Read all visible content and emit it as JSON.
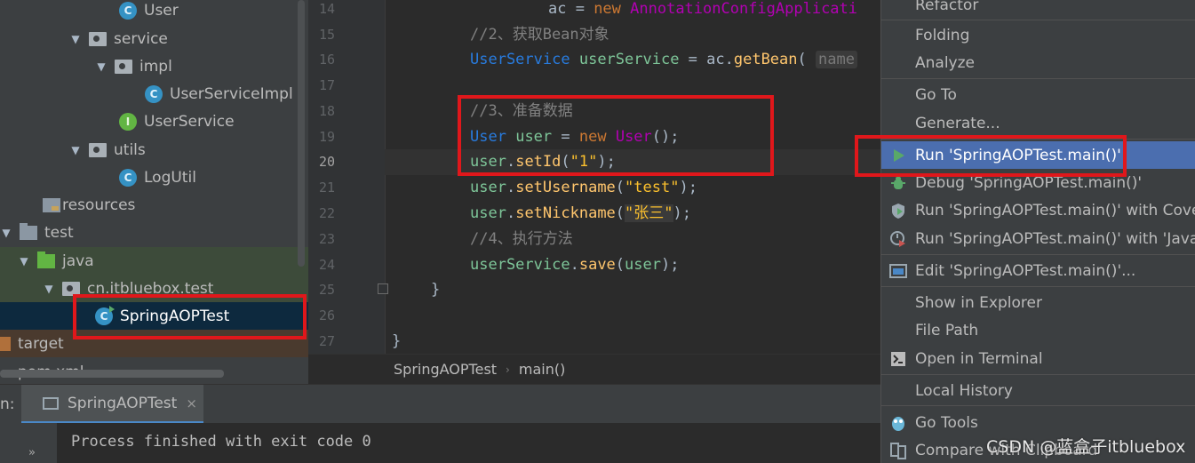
{
  "project_tree": {
    "items": [
      {
        "label": "User",
        "icon": "class-icon"
      },
      {
        "label": "service",
        "icon": "package-icon"
      },
      {
        "label": "impl",
        "icon": "package-icon"
      },
      {
        "label": "UserServiceImpl",
        "icon": "class-icon"
      },
      {
        "label": "UserService",
        "icon": "interface-icon"
      },
      {
        "label": "utils",
        "icon": "package-icon"
      },
      {
        "label": "LogUtil",
        "icon": "class-icon"
      },
      {
        "label": "resources",
        "icon": "resources-folder-icon"
      },
      {
        "label": "test",
        "icon": "folder-icon"
      },
      {
        "label": "java",
        "icon": "test-source-folder-icon"
      },
      {
        "label": "cn.itbluebox.test",
        "icon": "package-icon"
      },
      {
        "label": "SpringAOPTest",
        "icon": "runnable-class-icon"
      },
      {
        "label": "target",
        "icon": "excluded-folder-icon"
      },
      {
        "label": "pom.xml",
        "icon": "maven-icon"
      }
    ]
  },
  "editor": {
    "line_numbers": [
      "14",
      "15",
      "16",
      "17",
      "18",
      "19",
      "20",
      "21",
      "22",
      "23",
      "24",
      "25",
      "26",
      "27"
    ],
    "current_line": "20",
    "code": {
      "l14_assign": "ac = ",
      "l14_new": "new ",
      "l14_class": "AnnotationConfigApplicati",
      "l15": "//2、获取Bean对象",
      "l16_type": "UserService",
      "l16_var": "userService",
      "l16_eq": " = ac.",
      "l16_fn": "getBean",
      "l16_paren": "( ",
      "l16_hint": "name",
      "l18": "//3、准备数据",
      "l19_type": "User",
      "l19_var": "user",
      "l19_eq": " = ",
      "l19_new": "new ",
      "l19_class": "User",
      "l19_end": "();",
      "l20_obj": "user",
      "l20_dot": ".",
      "l20_fn": "setId",
      "l20_open": "(",
      "l20_str": "\"1\"",
      "l20_close": ");",
      "l21_obj": "user",
      "l21_fn": "setUsername",
      "l21_str": "\"test\"",
      "l22_obj": "user",
      "l22_fn": "setNickname",
      "l22_str": "\"张三\"",
      "l23": "//4、执行方法",
      "l24_obj": "userService",
      "l24_fn": "save",
      "l24_arg": "user",
      "l25": "}",
      "l27": "}"
    },
    "breadcrumb": [
      "SpringAOPTest",
      "main()"
    ]
  },
  "run_panel": {
    "label": "n:",
    "tab_label": "SpringAOPTest",
    "tab_close": "×",
    "expand": "»",
    "console_output": "Process finished with exit code 0"
  },
  "context_menu": {
    "items": {
      "refactor": "Refactor",
      "folding": "Folding",
      "analyze": "Analyze",
      "goto": "Go To",
      "generate": "Generate...",
      "run": "Run 'SpringAOPTest.main()'",
      "debug": "Debug 'SpringAOPTest.main()'",
      "run_coverage": "Run 'SpringAOPTest.main()' with Covera",
      "run_flight": "Run 'SpringAOPTest.main()' with 'Java F",
      "edit_config": "Edit 'SpringAOPTest.main()'...",
      "show_explorer": "Show in Explorer",
      "file_path": "File Path",
      "open_terminal": "Open in Terminal",
      "local_history": "Local History",
      "go_tools": "Go Tools",
      "compare_clipboard": "Compare with Clipboard"
    }
  },
  "watermark": "CSDN @蓝盒子itbluebox",
  "colors": {
    "annotation_red": "#e0171b",
    "menu_highlight": "#4b6eaf",
    "run_green": "#59a869"
  }
}
